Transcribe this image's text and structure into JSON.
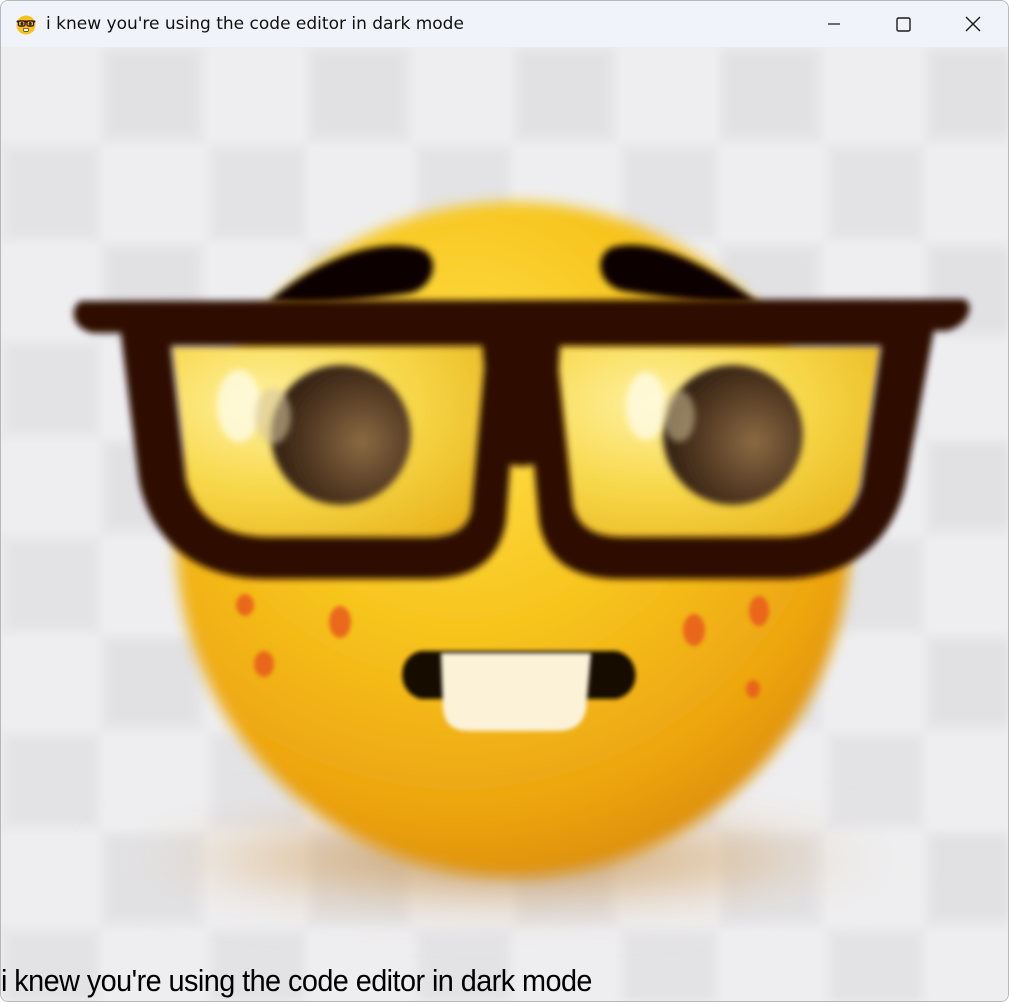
{
  "window": {
    "title": "i knew you're using the code editor in dark mode",
    "app_icon": "nerd-face-emoji-icon",
    "controls": {
      "minimize_icon": "minimize-icon",
      "maximize_icon": "maximize-icon",
      "close_icon": "close-icon"
    }
  },
  "content": {
    "image": "nerd-face-emoji",
    "caption": "i knew you're using the code editor in dark mode"
  },
  "colors": {
    "titlebar": "#f0f3f9",
    "background": "#eeeef0",
    "emoji_face": "#f6c21c",
    "glasses_frame": "#2e0c04",
    "caption_text": "#000000"
  }
}
